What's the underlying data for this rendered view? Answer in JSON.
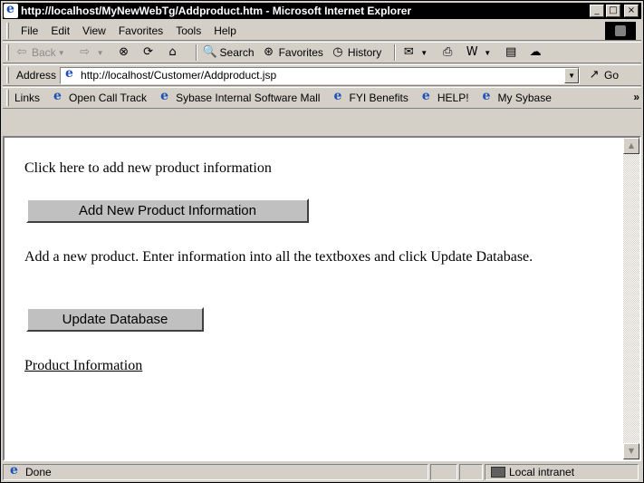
{
  "window": {
    "title": "http://localhost/MyNewWebTg/Addproduct.htm - Microsoft Internet Explorer",
    "min_glyph": "_",
    "max_glyph": "□",
    "close_glyph": "×"
  },
  "menu": {
    "items": [
      "File",
      "Edit",
      "View",
      "Favorites",
      "Tools",
      "Help"
    ]
  },
  "toolbar": {
    "back_label": "Back",
    "search_label": "Search",
    "favorites_label": "Favorites",
    "history_label": "History"
  },
  "address": {
    "label": "Address",
    "url": "http://localhost/Customer/Addproduct.jsp",
    "go_label": "Go"
  },
  "links": {
    "label": "Links",
    "items": [
      "Open Call Track",
      "Sybase Internal Software Mall",
      "FYI Benefits",
      "HELP!",
      "My Sybase"
    ],
    "more": "»"
  },
  "page": {
    "intro_text": "Click here to add new product information",
    "add_button": "Add New Product Information",
    "instructions": "Add a new product. Enter information into all the textboxes and click Update Database.",
    "update_button": "Update Database",
    "product_link": "Product Information"
  },
  "status": {
    "text": "Done",
    "zone": "Local intranet"
  }
}
